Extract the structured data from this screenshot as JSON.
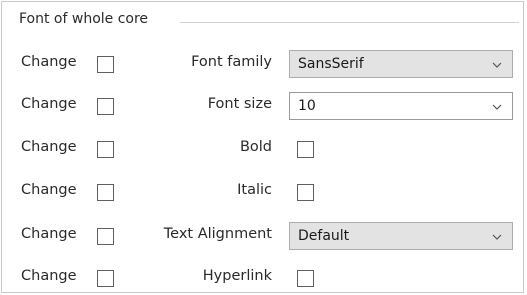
{
  "group": {
    "title": "Font of whole core"
  },
  "rows": [
    {
      "change_label": "Change",
      "label": "Font family",
      "value": "SansSerif"
    },
    {
      "change_label": "Change",
      "label": "Font size",
      "value": "10"
    },
    {
      "change_label": "Change",
      "label": "Bold"
    },
    {
      "change_label": "Change",
      "label": "Italic"
    },
    {
      "change_label": "Change",
      "label": "Text Alignment",
      "value": "Default"
    },
    {
      "change_label": "Change",
      "label": "Hyperlink"
    }
  ],
  "icons": {
    "dropdown": "chevron-down-icon"
  },
  "colors": {
    "readonly_combo_background": "#e3e3e3",
    "checkbox_border": "#5f5f5f"
  }
}
